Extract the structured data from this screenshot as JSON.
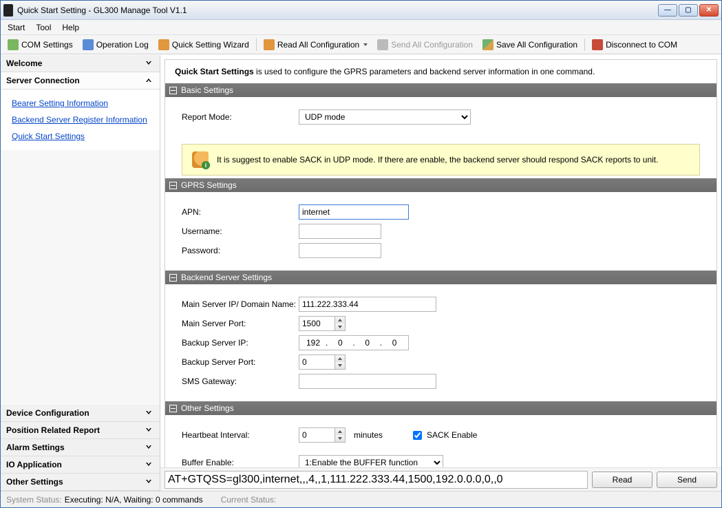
{
  "title": "Quick Start Setting - GL300 Manage Tool V1.1",
  "menu": {
    "start": "Start",
    "tool": "Tool",
    "help": "Help"
  },
  "toolbar": {
    "com_settings": "COM Settings",
    "operation_log": "Operation Log",
    "quick_wizard": "Quick Setting Wizard",
    "read_all": "Read All Configuration",
    "send_all": "Send All Configuration",
    "save_all": "Save All Configuration",
    "disconnect": "Disconnect to COM"
  },
  "sidebar": {
    "welcome": "Welcome",
    "server_connection": "Server Connection",
    "links": {
      "bearer": "Bearer Setting Information",
      "backend": "Backend Server Register Information",
      "quickstart": "Quick Start Settings"
    },
    "device_config": "Device Configuration",
    "position_report": "Position Related Report",
    "alarm": "Alarm Settings",
    "io": "IO Application",
    "other": "Other Settings"
  },
  "intro": {
    "bold": "Quick Start Settings",
    "rest": " is used to configure the GPRS parameters and backend server information in one command."
  },
  "basic": {
    "header": "Basic Settings",
    "report_mode_label": "Report Mode:",
    "report_mode_value": "UDP mode",
    "hint": "It is suggest to enable SACK in UDP mode. If there are enable, the backend server should respond SACK reports to unit."
  },
  "gprs": {
    "header": "GPRS Settings",
    "apn_label": "APN:",
    "apn_value": "internet",
    "username_label": "Username:",
    "username_value": "",
    "password_label": "Password:",
    "password_value": ""
  },
  "backend": {
    "header": "Backend Server Settings",
    "main_ip_label": "Main Server IP/ Domain Name:",
    "main_ip_value": "111.222.333.44",
    "main_port_label": "Main Server Port:",
    "main_port_value": "1500",
    "backup_ip_label": "Backup Server IP:",
    "backup_ip": {
      "a": "192",
      "b": "0",
      "c": "0",
      "d": "0"
    },
    "backup_port_label": "Backup Server Port:",
    "backup_port_value": "0",
    "sms_label": "SMS Gateway:",
    "sms_value": ""
  },
  "other": {
    "header": "Other Settings",
    "hb_label": "Heartbeat Interval:",
    "hb_value": "0",
    "hb_unit": "minutes",
    "sack_label": "SACK Enable",
    "sack_checked": true,
    "buffer_label": "Buffer Enable:",
    "buffer_value": "1:Enable the BUFFER function"
  },
  "cmd": {
    "text": "AT+GTQSS=gl300,internet,,,4,,1,111.222.333.44,1500,192.0.0.0,0,,0",
    "read": "Read",
    "send": "Send"
  },
  "status": {
    "sys_label": "System Status:",
    "sys_value": "Executing: N/A, Waiting: 0 commands",
    "cur_label": "Current Status:"
  }
}
